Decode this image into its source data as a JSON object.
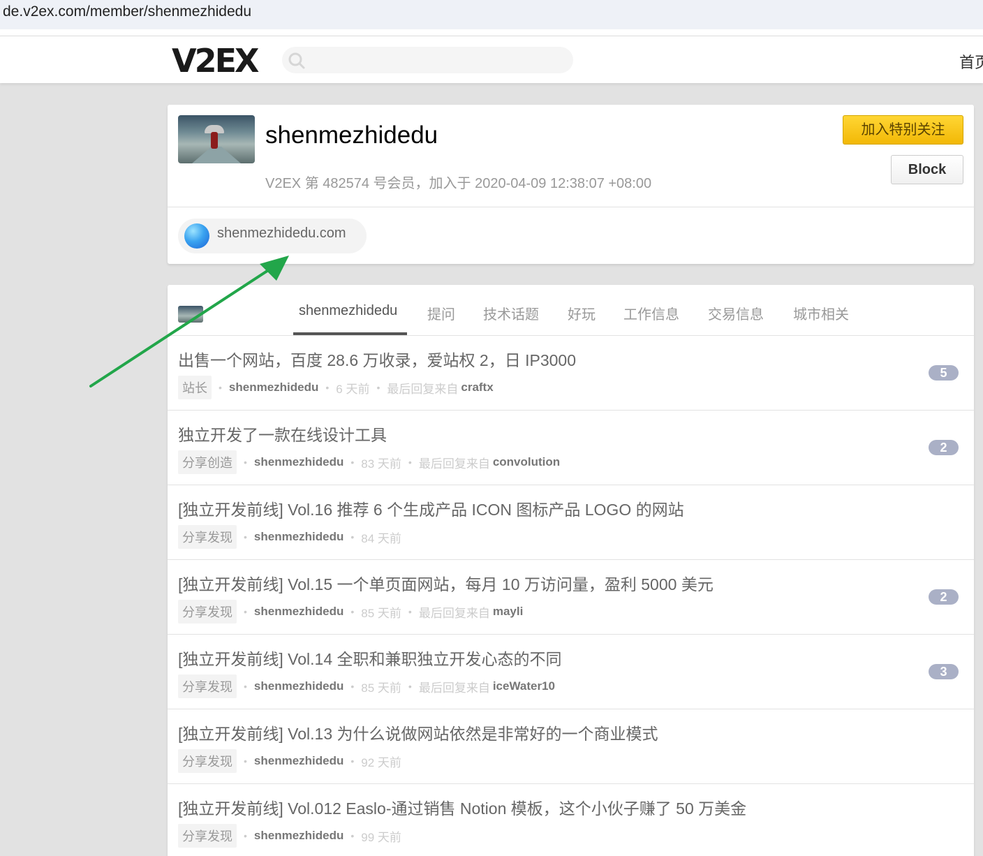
{
  "browser": {
    "url": "de.v2ex.com/member/shenmezhidedu"
  },
  "topbar": {
    "logo": "V2EX",
    "search_placeholder": "",
    "home_link": "首页"
  },
  "profile": {
    "username": "shenmezhidedu",
    "member_info": "V2EX 第 482574 号会员，加入于 2020-04-09 12:38:07 +08:00",
    "follow_label": "加入特别关注",
    "block_label": "Block",
    "website": "shenmezhidedu.com"
  },
  "tabs": [
    {
      "label": "shenmezhidedu",
      "active": true
    },
    {
      "label": "提问"
    },
    {
      "label": "技术话题"
    },
    {
      "label": "好玩"
    },
    {
      "label": "工作信息"
    },
    {
      "label": "交易信息"
    },
    {
      "label": "城市相关"
    }
  ],
  "topics": [
    {
      "title": "出售一个网站，百度 28.6 万收录，爱站权 2，日 IP3000",
      "node": "站长",
      "author": "shenmezhidedu",
      "time": "6 天前",
      "last_reply_label": "最后回复来自",
      "last_reply_by": "craftx",
      "replies": "5"
    },
    {
      "title": "独立开发了一款在线设计工具",
      "node": "分享创造",
      "author": "shenmezhidedu",
      "time": "83 天前",
      "last_reply_label": "最后回复来自",
      "last_reply_by": "convolution",
      "replies": "2"
    },
    {
      "title": "[独立开发前线] Vol.16 推荐 6 个生成产品 ICON 图标产品 LOGO 的网站",
      "node": "分享发现",
      "author": "shenmezhidedu",
      "time": "84 天前",
      "last_reply_label": "",
      "last_reply_by": "",
      "replies": ""
    },
    {
      "title": "[独立开发前线] Vol.15 一个单页面网站，每月 10 万访问量，盈利 5000 美元",
      "node": "分享发现",
      "author": "shenmezhidedu",
      "time": "85 天前",
      "last_reply_label": "最后回复来自",
      "last_reply_by": "mayli",
      "replies": "2"
    },
    {
      "title": "[独立开发前线] Vol.14 全职和兼职独立开发心态的不同",
      "node": "分享发现",
      "author": "shenmezhidedu",
      "time": "85 天前",
      "last_reply_label": "最后回复来自",
      "last_reply_by": "iceWater10",
      "replies": "3"
    },
    {
      "title": "[独立开发前线] Vol.13 为什么说做网站依然是非常好的一个商业模式",
      "node": "分享发现",
      "author": "shenmezhidedu",
      "time": "92 天前",
      "last_reply_label": "",
      "last_reply_by": "",
      "replies": ""
    },
    {
      "title": "[独立开发前线] Vol.012 Easlo-通过销售 Notion 模板，这个小伙子赚了 50 万美金",
      "node": "分享发现",
      "author": "shenmezhidedu",
      "time": "99 天前",
      "last_reply_label": "",
      "last_reply_by": "",
      "replies": ""
    }
  ],
  "colors": {
    "accent_yellow": "#f2b806",
    "annotation_arrow": "#22a64a",
    "reply_badge": "#aab0c6"
  }
}
